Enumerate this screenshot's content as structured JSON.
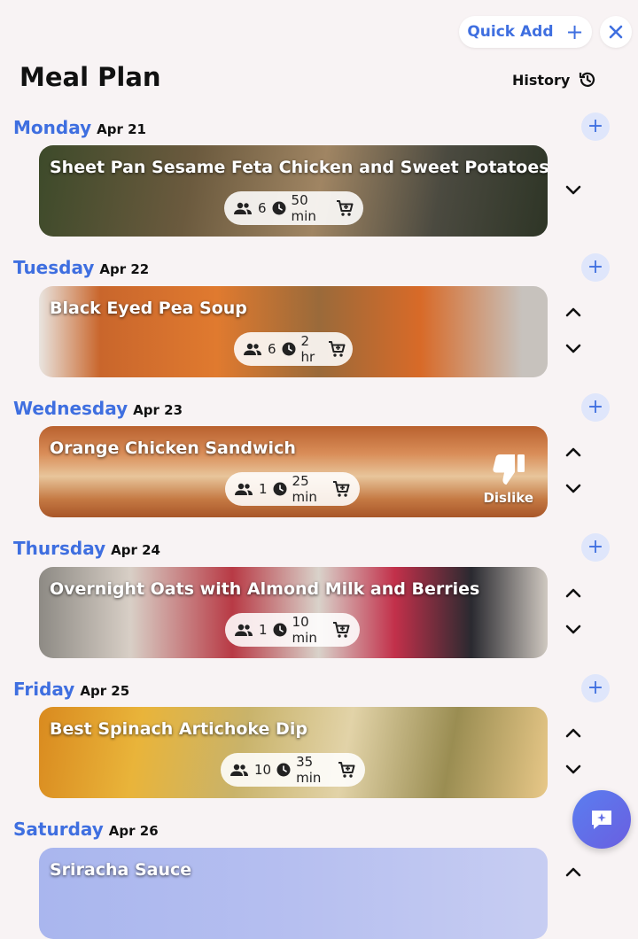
{
  "header": {
    "quick_add_label": "Quick Add",
    "title": "Meal Plan",
    "history_label": "History"
  },
  "days": [
    {
      "name": "Monday",
      "date": "Apr 21",
      "meal": {
        "title": "Sheet Pan Sesame Feta Chicken and Sweet Potatoes.",
        "servings": "6",
        "time": "50 min"
      }
    },
    {
      "name": "Tuesday",
      "date": "Apr 22",
      "meal": {
        "title": "Black Eyed Pea Soup",
        "servings": "6",
        "time": "2 hr"
      }
    },
    {
      "name": "Wednesday",
      "date": "Apr 23",
      "meal": {
        "title": "Orange Chicken Sandwich",
        "servings": "1",
        "time": "25 min",
        "dislike_label": "Dislike"
      }
    },
    {
      "name": "Thursday",
      "date": "Apr 24",
      "meal": {
        "title": "Overnight Oats with Almond Milk and Berries",
        "servings": "1",
        "time": "10 min"
      }
    },
    {
      "name": "Friday",
      "date": "Apr 25",
      "meal": {
        "title": "Best Spinach Artichoke Dip",
        "servings": "10",
        "time": "35 min"
      }
    },
    {
      "name": "Saturday",
      "date": "Apr 26",
      "meal": {
        "title": "Sriracha Sauce"
      }
    }
  ],
  "colors": {
    "accent": "#3f6fe0",
    "background": "#f8f3f4",
    "add_button_bg": "#dfe6fb"
  },
  "icons": [
    "plus-icon",
    "close-icon",
    "history-icon",
    "people-icon",
    "clock-icon",
    "cart-icon",
    "chevron-up-icon",
    "chevron-down-icon",
    "thumbs-down-icon",
    "chat-sparkle-icon"
  ]
}
